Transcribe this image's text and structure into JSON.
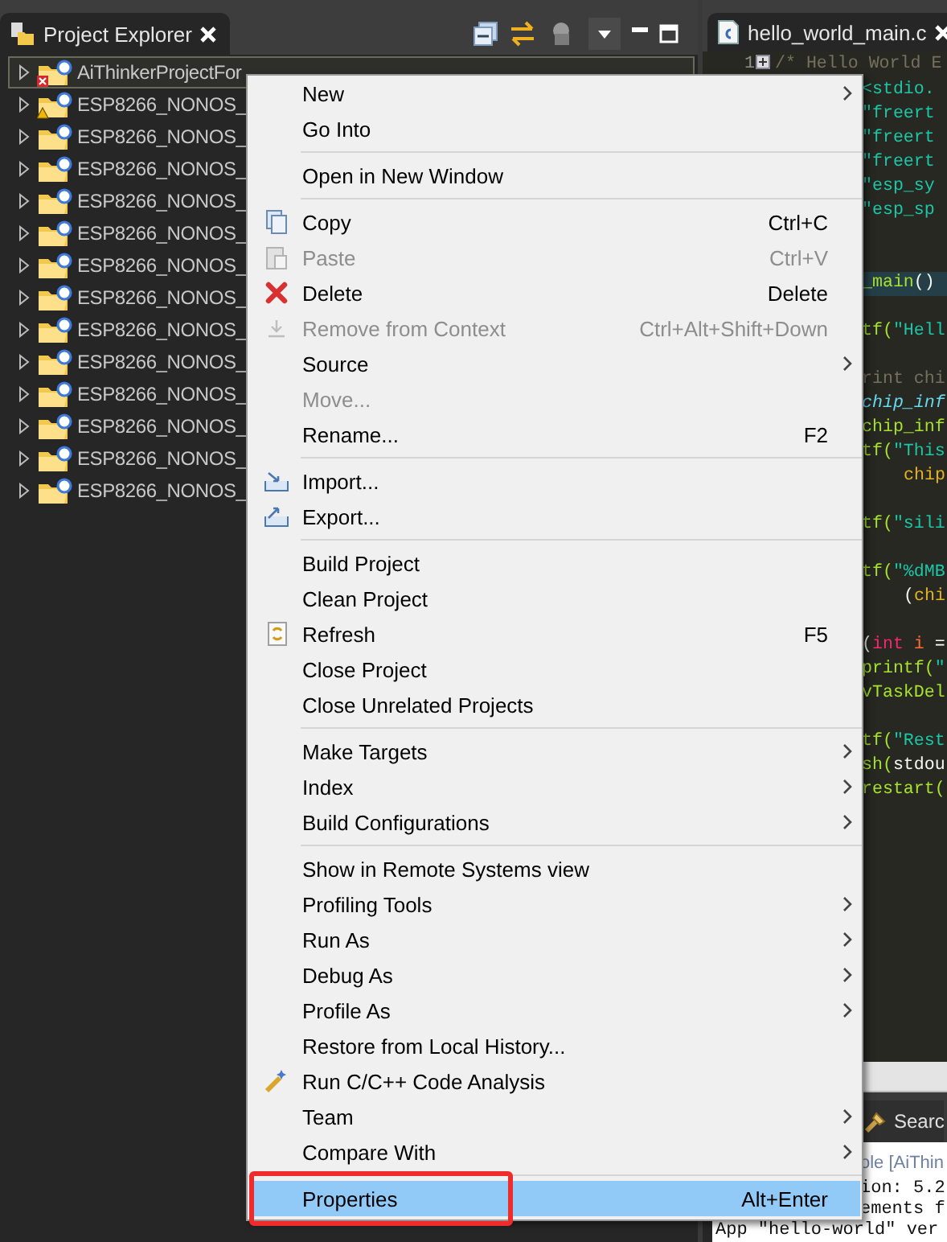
{
  "explorer": {
    "tab": {
      "title": "Project Explorer"
    },
    "tree": [
      {
        "name": "AiThinkerProjectFor",
        "has_error": true,
        "has_warning": false,
        "selected": true
      },
      {
        "name": "ESP8266_NONOS_",
        "has_error": false,
        "has_warning": true,
        "selected": false
      },
      {
        "name": "ESP8266_NONOS_",
        "has_error": false,
        "has_warning": false,
        "selected": false
      },
      {
        "name": "ESP8266_NONOS_",
        "has_error": false,
        "has_warning": false,
        "selected": false
      },
      {
        "name": "ESP8266_NONOS_",
        "has_error": false,
        "has_warning": false,
        "selected": false
      },
      {
        "name": "ESP8266_NONOS_",
        "has_error": false,
        "has_warning": false,
        "selected": false
      },
      {
        "name": "ESP8266_NONOS_",
        "has_error": false,
        "has_warning": false,
        "selected": false
      },
      {
        "name": "ESP8266_NONOS_",
        "has_error": false,
        "has_warning": false,
        "selected": false
      },
      {
        "name": "ESP8266_NONOS_",
        "has_error": false,
        "has_warning": false,
        "selected": false
      },
      {
        "name": "ESP8266_NONOS_",
        "has_error": false,
        "has_warning": false,
        "selected": false
      },
      {
        "name": "ESP8266_NONOS_",
        "has_error": false,
        "has_warning": false,
        "selected": false
      },
      {
        "name": "ESP8266_NONOS_",
        "has_error": false,
        "has_warning": false,
        "selected": false
      },
      {
        "name": "ESP8266_NONOS_",
        "has_error": false,
        "has_warning": false,
        "selected": false
      },
      {
        "name": "ESP8266_NONOS_",
        "has_error": false,
        "has_warning": false,
        "selected": false
      }
    ]
  },
  "editor": {
    "tab": {
      "title": "hello_world_main.c"
    },
    "lines": [
      {
        "kind": "code",
        "line_number": "1",
        "current": false,
        "segments": [
          {
            "text": "/* Hello World E",
            "kind": "comment"
          }
        ]
      },
      {
        "kind": "code",
        "clipped": true,
        "indented": false,
        "current": false,
        "segments": [
          {
            "text": "<stdio.",
            "kind": "string"
          }
        ]
      },
      {
        "kind": "code",
        "clipped": true,
        "indented": false,
        "current": false,
        "segments": [
          {
            "text": "\"freert",
            "kind": "string"
          }
        ]
      },
      {
        "kind": "code",
        "clipped": true,
        "indented": false,
        "current": false,
        "segments": [
          {
            "text": "\"freert",
            "kind": "string"
          }
        ]
      },
      {
        "kind": "code",
        "clipped": true,
        "indented": false,
        "current": false,
        "segments": [
          {
            "text": "\"freert",
            "kind": "string"
          }
        ]
      },
      {
        "kind": "code",
        "clipped": true,
        "indented": false,
        "current": false,
        "segments": [
          {
            "text": "\"esp_sy",
            "kind": "string"
          }
        ]
      },
      {
        "kind": "code",
        "clipped": true,
        "indented": false,
        "current": false,
        "segments": [
          {
            "text": "\"esp_sp",
            "kind": "string"
          }
        ]
      },
      {
        "kind": "blank"
      },
      {
        "kind": "blank"
      },
      {
        "kind": "code",
        "clipped": true,
        "indented": false,
        "current": true,
        "segments": [
          {
            "text": "_main",
            "kind": "function"
          },
          {
            "text": "()",
            "kind": "plain"
          }
        ]
      },
      {
        "kind": "blank"
      },
      {
        "kind": "code",
        "clipped": true,
        "indented": false,
        "current": false,
        "segments": [
          {
            "text": "tf(",
            "kind": "function"
          },
          {
            "text": "\"Hell",
            "kind": "string"
          }
        ]
      },
      {
        "kind": "blank"
      },
      {
        "kind": "code",
        "clipped": true,
        "indented": false,
        "current": false,
        "segments": [
          {
            "text": "rint chi",
            "kind": "comment"
          }
        ]
      },
      {
        "kind": "code",
        "clipped": true,
        "indented": false,
        "current": false,
        "segments": [
          {
            "text": "chip_inf",
            "kind": "type"
          }
        ]
      },
      {
        "kind": "code",
        "clipped": true,
        "indented": false,
        "current": false,
        "segments": [
          {
            "text": "chip_inf",
            "kind": "function"
          }
        ]
      },
      {
        "kind": "code",
        "clipped": true,
        "indented": false,
        "current": false,
        "segments": [
          {
            "text": "tf(",
            "kind": "function"
          },
          {
            "text": "\"This",
            "kind": "string"
          }
        ]
      },
      {
        "kind": "code",
        "clipped": true,
        "indented": true,
        "current": false,
        "segments": [
          {
            "text": "chip",
            "kind": "field"
          }
        ]
      },
      {
        "kind": "blank"
      },
      {
        "kind": "code",
        "clipped": true,
        "indented": false,
        "current": false,
        "segments": [
          {
            "text": "tf(",
            "kind": "function"
          },
          {
            "text": "\"sili",
            "kind": "string"
          }
        ]
      },
      {
        "kind": "blank"
      },
      {
        "kind": "code",
        "clipped": true,
        "indented": false,
        "current": false,
        "segments": [
          {
            "text": "tf(",
            "kind": "function"
          },
          {
            "text": "\"%dMB",
            "kind": "string"
          }
        ]
      },
      {
        "kind": "code",
        "clipped": true,
        "indented": true,
        "current": false,
        "segments": [
          {
            "text": "(",
            "kind": "plain"
          },
          {
            "text": "chi",
            "kind": "field"
          }
        ]
      },
      {
        "kind": "blank"
      },
      {
        "kind": "code",
        "clipped": true,
        "indented": false,
        "current": false,
        "segments": [
          {
            "text": "(",
            "kind": "plain"
          },
          {
            "text": "int",
            "kind": "keyword"
          },
          {
            "text": " i ",
            "kind": "variable"
          },
          {
            "text": "=",
            "kind": "plain"
          }
        ]
      },
      {
        "kind": "code",
        "clipped": true,
        "indented": false,
        "current": false,
        "segments": [
          {
            "text": "printf(",
            "kind": "function"
          },
          {
            "text": "\"",
            "kind": "string"
          }
        ]
      },
      {
        "kind": "code",
        "clipped": true,
        "indented": false,
        "current": false,
        "segments": [
          {
            "text": "vTaskDel",
            "kind": "function"
          }
        ]
      },
      {
        "kind": "blank"
      },
      {
        "kind": "code",
        "clipped": true,
        "indented": false,
        "current": false,
        "segments": [
          {
            "text": "tf(",
            "kind": "function"
          },
          {
            "text": "\"Rest",
            "kind": "string"
          }
        ]
      },
      {
        "kind": "code",
        "clipped": true,
        "indented": false,
        "current": false,
        "segments": [
          {
            "text": "sh(",
            "kind": "function"
          },
          {
            "text": "stdou",
            "kind": "plain"
          }
        ]
      },
      {
        "kind": "code",
        "clipped": true,
        "indented": false,
        "current": false,
        "segments": [
          {
            "text": "restart(",
            "kind": "function"
          }
        ]
      }
    ]
  },
  "bottom": {
    "tab": {
      "label": "Searc"
    },
    "console": [
      {
        "text": "ole [AiThin",
        "kind": "header",
        "clipped": true
      },
      {
        "text": "ion: 5.2",
        "kind": "output",
        "clipped": true
      },
      {
        "text": "ements f",
        "kind": "output",
        "clipped": true
      },
      {
        "text": "App \"hello-world\" ver",
        "kind": "output",
        "clipped": false
      }
    ]
  },
  "menu": {
    "items": [
      {
        "kind": "item",
        "label": "New",
        "submenu": true,
        "disabled": false,
        "selected": false,
        "annotated": false
      },
      {
        "kind": "item",
        "label": "Go Into",
        "submenu": false,
        "disabled": false,
        "selected": false,
        "annotated": false
      },
      {
        "kind": "separator"
      },
      {
        "kind": "item",
        "label": "Open in New Window",
        "submenu": false,
        "disabled": false,
        "selected": false,
        "annotated": false
      },
      {
        "kind": "separator"
      },
      {
        "kind": "item",
        "label": "Copy",
        "shortcut": "Ctrl+C",
        "submenu": false,
        "disabled": false,
        "selected": false,
        "annotated": false
      },
      {
        "kind": "item",
        "label": "Paste",
        "shortcut": "Ctrl+V",
        "submenu": false,
        "disabled": true,
        "selected": false,
        "annotated": false
      },
      {
        "kind": "item",
        "label": "Delete",
        "shortcut": "Delete",
        "submenu": false,
        "disabled": false,
        "selected": false,
        "annotated": false
      },
      {
        "kind": "item",
        "label": "Remove from Context",
        "shortcut": "Ctrl+Alt+Shift+Down",
        "submenu": false,
        "disabled": true,
        "selected": false,
        "annotated": false
      },
      {
        "kind": "item",
        "label": "Source",
        "submenu": true,
        "disabled": false,
        "selected": false,
        "annotated": false
      },
      {
        "kind": "item",
        "label": "Move...",
        "submenu": false,
        "disabled": true,
        "selected": false,
        "annotated": false
      },
      {
        "kind": "item",
        "label": "Rename...",
        "shortcut": "F2",
        "submenu": false,
        "disabled": false,
        "selected": false,
        "annotated": false
      },
      {
        "kind": "separator"
      },
      {
        "kind": "item",
        "label": "Import...",
        "submenu": false,
        "disabled": false,
        "selected": false,
        "annotated": false
      },
      {
        "kind": "item",
        "label": "Export...",
        "submenu": false,
        "disabled": false,
        "selected": false,
        "annotated": false
      },
      {
        "kind": "separator"
      },
      {
        "kind": "item",
        "label": "Build Project",
        "submenu": false,
        "disabled": false,
        "selected": false,
        "annotated": false
      },
      {
        "kind": "item",
        "label": "Clean Project",
        "submenu": false,
        "disabled": false,
        "selected": false,
        "annotated": false
      },
      {
        "kind": "item",
        "label": "Refresh",
        "shortcut": "F5",
        "submenu": false,
        "disabled": false,
        "selected": false,
        "annotated": false
      },
      {
        "kind": "item",
        "label": "Close Project",
        "submenu": false,
        "disabled": false,
        "selected": false,
        "annotated": false
      },
      {
        "kind": "item",
        "label": "Close Unrelated Projects",
        "submenu": false,
        "disabled": false,
        "selected": false,
        "annotated": false
      },
      {
        "kind": "separator"
      },
      {
        "kind": "item",
        "label": "Make Targets",
        "submenu": true,
        "disabled": false,
        "selected": false,
        "annotated": false
      },
      {
        "kind": "item",
        "label": "Index",
        "submenu": true,
        "disabled": false,
        "selected": false,
        "annotated": false
      },
      {
        "kind": "item",
        "label": "Build Configurations",
        "submenu": true,
        "disabled": false,
        "selected": false,
        "annotated": false
      },
      {
        "kind": "separator"
      },
      {
        "kind": "item",
        "label": "Show in Remote Systems view",
        "submenu": false,
        "disabled": false,
        "selected": false,
        "annotated": false
      },
      {
        "kind": "item",
        "label": "Profiling Tools",
        "submenu": true,
        "disabled": false,
        "selected": false,
        "annotated": false
      },
      {
        "kind": "item",
        "label": "Run As",
        "submenu": true,
        "disabled": false,
        "selected": false,
        "annotated": false
      },
      {
        "kind": "item",
        "label": "Debug As",
        "submenu": true,
        "disabled": false,
        "selected": false,
        "annotated": false
      },
      {
        "kind": "item",
        "label": "Profile As",
        "submenu": true,
        "disabled": false,
        "selected": false,
        "annotated": false
      },
      {
        "kind": "item",
        "label": "Restore from Local History...",
        "submenu": false,
        "disabled": false,
        "selected": false,
        "annotated": false
      },
      {
        "kind": "item",
        "label": "Run C/C++ Code Analysis",
        "submenu": false,
        "disabled": false,
        "selected": false,
        "annotated": false
      },
      {
        "kind": "item",
        "label": "Team",
        "submenu": true,
        "disabled": false,
        "selected": false,
        "annotated": false
      },
      {
        "kind": "item",
        "label": "Compare With",
        "submenu": true,
        "disabled": false,
        "selected": false,
        "annotated": false
      },
      {
        "kind": "separator"
      },
      {
        "kind": "item",
        "label": "Properties",
        "shortcut": "Alt+Enter",
        "submenu": false,
        "disabled": false,
        "selected": true,
        "annotated": true
      }
    ]
  }
}
